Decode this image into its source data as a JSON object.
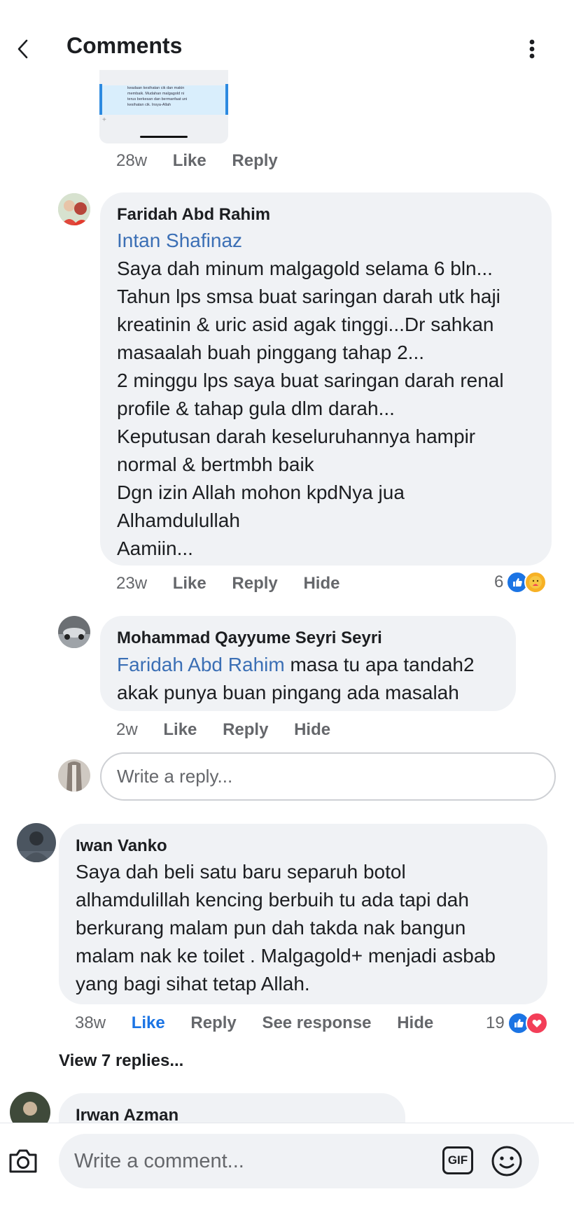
{
  "header": {
    "title": "Comments"
  },
  "thumb": {
    "snippet_lines": [
      "keadaan kesihatan cik dan makin",
      "membaik. Mudahan malgagold ni",
      "terus berkesan dan bermanfaat uni",
      "kesihatan cik. Insya-Allah"
    ],
    "time": "28w",
    "like": "Like",
    "reply": "Reply"
  },
  "comments": [
    {
      "name": "Faridah Abd Rahim",
      "mention": "Intan Shafinaz",
      "lines": [
        "Saya dah minum malgagold selama 6 bln...",
        "Tahun lps smsa buat saringan darah utk haji",
        "kreatinin & uric asid agak tinggi...Dr sahkan",
        "masaalah buah pinggang tahap 2...",
        "2 minggu lps saya buat saringan darah renal",
        "profile & tahap gula dlm darah...",
        "Keputusan darah keseluruhannya hampir",
        "normal & bertmbh baik",
        "Dgn izin Allah mohon kpdNya jua",
        "Alhamdulullah",
        "Aamiin..."
      ],
      "time": "23w",
      "like": "Like",
      "reply": "Reply",
      "hide": "Hide",
      "reaction_count": "6"
    },
    {
      "name": "Mohammad Qayyume Seyri Seyri",
      "mention": "Faridah Abd Rahim",
      "line1_rest": " masa tu apa tandah2",
      "line2": "akak punya buan pingang ada masalah",
      "time": "2w",
      "like": "Like",
      "reply": "Reply",
      "hide": "Hide"
    },
    {
      "name": "Iwan Vanko",
      "lines": [
        "Saya dah beli satu baru separuh botol",
        "alhamdulillah kencing berbuih tu ada tapi dah",
        "berkurang malam pun dah takda nak bangun",
        "malam nak ke toilet . Malgagold+ menjadi asbab",
        "yang bagi sihat tetap Allah."
      ],
      "time": "38w",
      "like": "Like",
      "reply": "Reply",
      "see_response": "See response",
      "hide": "Hide",
      "reaction_count": "19",
      "view_replies": "View 7 replies..."
    },
    {
      "name": "Irwan Azman"
    }
  ],
  "reply_box": {
    "placeholder": "Write a reply..."
  },
  "comment_box": {
    "placeholder": "Write a comment...",
    "gif_label": "GIF"
  },
  "colors": {
    "mention": "#3b6fb5",
    "like_active": "#1b74e4",
    "bubble": "#f0f2f5",
    "meta": "#65676b",
    "love": "#f33e58"
  },
  "icons": [
    "chevron-left-icon",
    "more-vertical-icon",
    "like-reaction-icon",
    "care-reaction-icon",
    "love-reaction-icon",
    "camera-icon",
    "gif-icon",
    "emoji-icon"
  ]
}
